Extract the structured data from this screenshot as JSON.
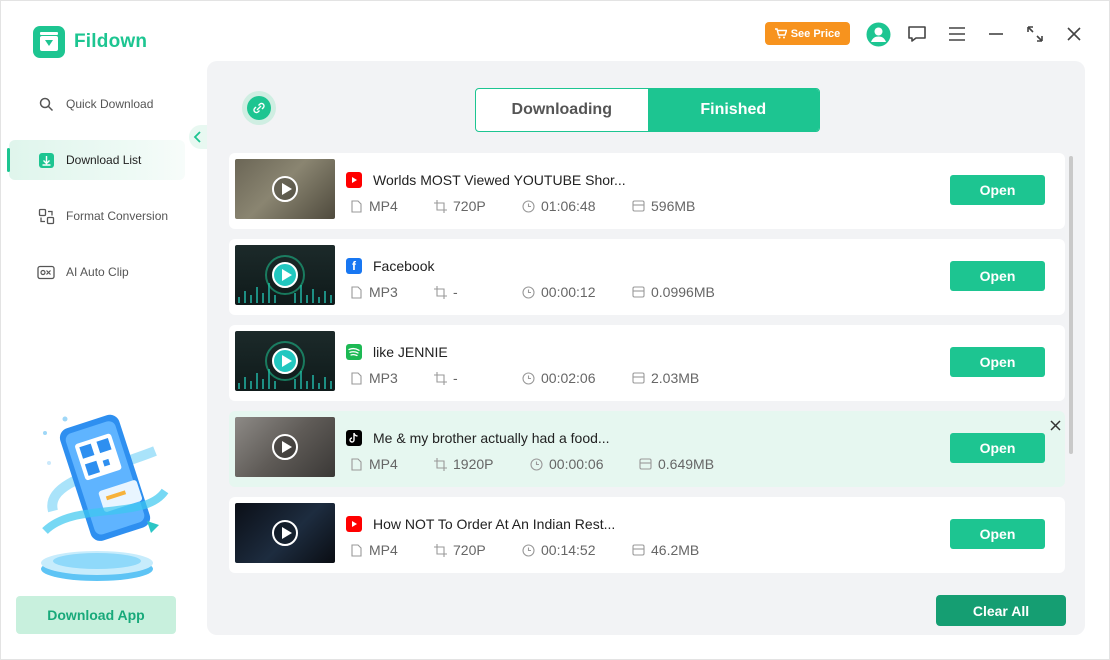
{
  "app": {
    "name": "Fildown",
    "accent": "#1dc591"
  },
  "header": {
    "see_price_label": "See Price",
    "icons": [
      "cart-icon",
      "user-icon",
      "feedback-icon",
      "menu-icon",
      "minimize-icon",
      "expand-icon",
      "close-icon"
    ]
  },
  "sidebar": {
    "items": [
      {
        "label": "Quick Download",
        "icon": "search-icon"
      },
      {
        "label": "Download List",
        "icon": "download-list-icon",
        "active": true
      },
      {
        "label": "Format Conversion",
        "icon": "format-conversion-icon"
      },
      {
        "label": "AI Auto Clip",
        "icon": "ai-clip-icon"
      }
    ],
    "download_app_label": "Download App"
  },
  "tabs": [
    {
      "label": "Downloading",
      "selected": false
    },
    {
      "label": "Finished",
      "selected": true
    }
  ],
  "downloads": [
    {
      "source": "youtube",
      "title": "Worlds MOST Viewed YOUTUBE Shor...",
      "format": "MP4",
      "resolution": "720P",
      "duration": "01:06:48",
      "size": "596MB",
      "open_label": "Open"
    },
    {
      "source": "facebook",
      "title": "Facebook",
      "format": "MP3",
      "resolution": "-",
      "duration": "00:00:12",
      "size": "0.0996MB",
      "open_label": "Open"
    },
    {
      "source": "spotify",
      "title": "like JENNIE",
      "format": "MP3",
      "resolution": "-",
      "duration": "00:02:06",
      "size": "2.03MB",
      "open_label": "Open"
    },
    {
      "source": "tiktok",
      "title": "Me & my brother actually had a food...",
      "format": "MP4",
      "resolution": "1920P",
      "duration": "00:00:06",
      "size": "0.649MB",
      "open_label": "Open",
      "hovered": true
    },
    {
      "source": "youtube",
      "title": "How NOT To Order At An Indian Rest...",
      "format": "MP4",
      "resolution": "720P",
      "duration": "00:14:52",
      "size": "46.2MB",
      "open_label": "Open"
    }
  ],
  "footer": {
    "clear_all_label": "Clear All"
  }
}
